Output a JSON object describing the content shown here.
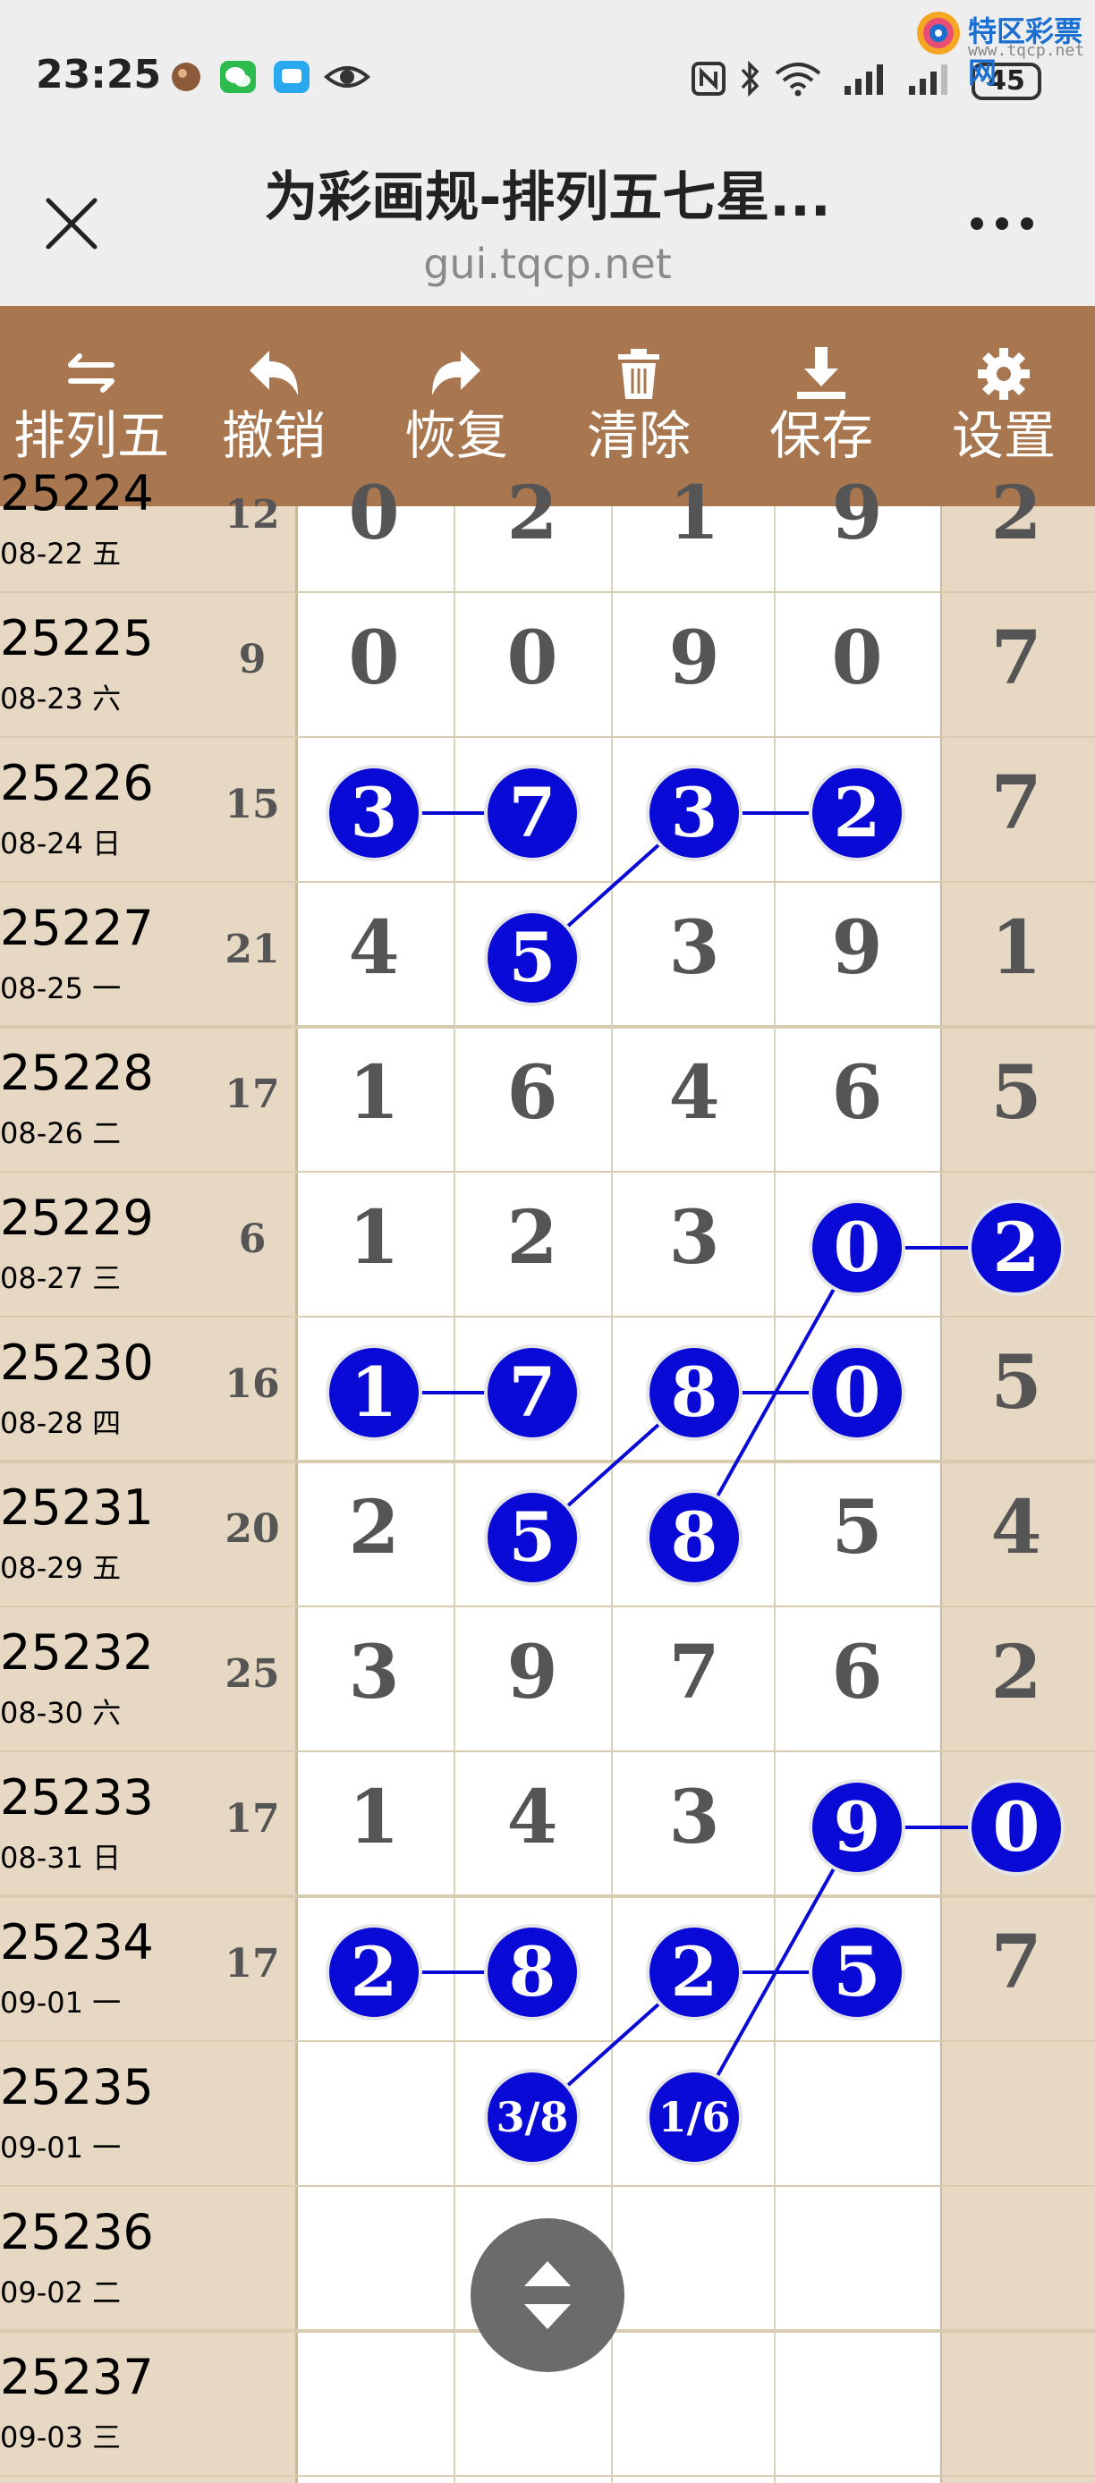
{
  "status": {
    "time": "23:25",
    "battery": "45",
    "watermark_text": "特区彩票网",
    "watermark_url": "www.tqcp.net"
  },
  "titlebar": {
    "title": "为彩画规-排列五七星...",
    "url": "gui.tqcp.net"
  },
  "toolbar": {
    "items": [
      {
        "label": "排列五",
        "icon": "swap-arrows-icon"
      },
      {
        "label": "撤销",
        "icon": "undo-icon"
      },
      {
        "label": "恢复",
        "icon": "redo-icon"
      },
      {
        "label": "清除",
        "icon": "trash-icon"
      },
      {
        "label": "保存",
        "icon": "download-icon"
      },
      {
        "label": "设置",
        "icon": "gear-icon"
      }
    ]
  },
  "colors": {
    "toolbar_bg": "#a8764f",
    "tan_column": "#e6d8c2",
    "ball_blue": "#0a0ad6",
    "grid_line": "#d8d6b8"
  },
  "grid": {
    "rows": [
      {
        "issue": "25224",
        "date": "08-22 五",
        "sum": "12",
        "digits": [
          "0",
          "2",
          "1",
          "9",
          "2"
        ]
      },
      {
        "issue": "25225",
        "date": "08-23 六",
        "sum": "9",
        "digits": [
          "0",
          "0",
          "9",
          "0",
          "7"
        ]
      },
      {
        "issue": "25226",
        "date": "08-24 日",
        "sum": "15",
        "digits": [
          "3",
          "7",
          "3",
          "2",
          "7"
        ]
      },
      {
        "issue": "25227",
        "date": "08-25 一",
        "sum": "21",
        "digits": [
          "4",
          "5",
          "3",
          "9",
          "1"
        ]
      },
      {
        "issue": "25228",
        "date": "08-26 二",
        "sum": "17",
        "digits": [
          "1",
          "6",
          "4",
          "6",
          "5"
        ]
      },
      {
        "issue": "25229",
        "date": "08-27 三",
        "sum": "6",
        "digits": [
          "1",
          "2",
          "3",
          "0",
          "2"
        ]
      },
      {
        "issue": "25230",
        "date": "08-28 四",
        "sum": "16",
        "digits": [
          "1",
          "7",
          "8",
          "0",
          "5"
        ]
      },
      {
        "issue": "25231",
        "date": "08-29 五",
        "sum": "20",
        "digits": [
          "2",
          "5",
          "8",
          "5",
          "4"
        ]
      },
      {
        "issue": "25232",
        "date": "08-30 六",
        "sum": "25",
        "digits": [
          "3",
          "9",
          "7",
          "6",
          "2"
        ]
      },
      {
        "issue": "25233",
        "date": "08-31 日",
        "sum": "17",
        "digits": [
          "1",
          "4",
          "3",
          "9",
          "0"
        ]
      },
      {
        "issue": "25234",
        "date": "09-01 一",
        "sum": "17",
        "digits": [
          "2",
          "8",
          "2",
          "5",
          "7"
        ]
      },
      {
        "issue": "25235",
        "date": "09-01 一",
        "sum": "",
        "digits": [
          "",
          "3/8",
          "1/6",
          "",
          ""
        ]
      },
      {
        "issue": "25236",
        "date": "09-02 二",
        "sum": "",
        "digits": [
          "",
          "",
          "",
          "",
          ""
        ]
      },
      {
        "issue": "25237",
        "date": "09-03 三",
        "sum": "",
        "digits": [
          "",
          "",
          "",
          "",
          ""
        ]
      }
    ],
    "circled": [
      [
        2,
        0
      ],
      [
        2,
        1
      ],
      [
        2,
        2
      ],
      [
        2,
        3
      ],
      [
        3,
        1
      ],
      [
        5,
        3
      ],
      [
        5,
        4
      ],
      [
        6,
        0
      ],
      [
        6,
        1
      ],
      [
        6,
        2
      ],
      [
        6,
        3
      ],
      [
        7,
        1
      ],
      [
        7,
        2
      ],
      [
        9,
        3
      ],
      [
        9,
        4
      ],
      [
        10,
        0
      ],
      [
        10,
        1
      ],
      [
        10,
        2
      ],
      [
        10,
        3
      ],
      [
        11,
        1
      ],
      [
        11,
        2
      ]
    ],
    "links": [
      [
        [
          2,
          0
        ],
        [
          2,
          1
        ]
      ],
      [
        [
          2,
          2
        ],
        [
          2,
          3
        ]
      ],
      [
        [
          2,
          2
        ],
        [
          3,
          1
        ]
      ],
      [
        [
          5,
          3
        ],
        [
          5,
          4
        ]
      ],
      [
        [
          5,
          3
        ],
        [
          7,
          2
        ]
      ],
      [
        [
          6,
          0
        ],
        [
          6,
          1
        ]
      ],
      [
        [
          6,
          2
        ],
        [
          6,
          3
        ]
      ],
      [
        [
          6,
          2
        ],
        [
          7,
          1
        ]
      ],
      [
        [
          9,
          3
        ],
        [
          9,
          4
        ]
      ],
      [
        [
          9,
          3
        ],
        [
          11,
          2
        ]
      ],
      [
        [
          10,
          0
        ],
        [
          10,
          1
        ]
      ],
      [
        [
          10,
          2
        ],
        [
          10,
          3
        ]
      ],
      [
        [
          10,
          2
        ],
        [
          11,
          1
        ]
      ]
    ]
  }
}
